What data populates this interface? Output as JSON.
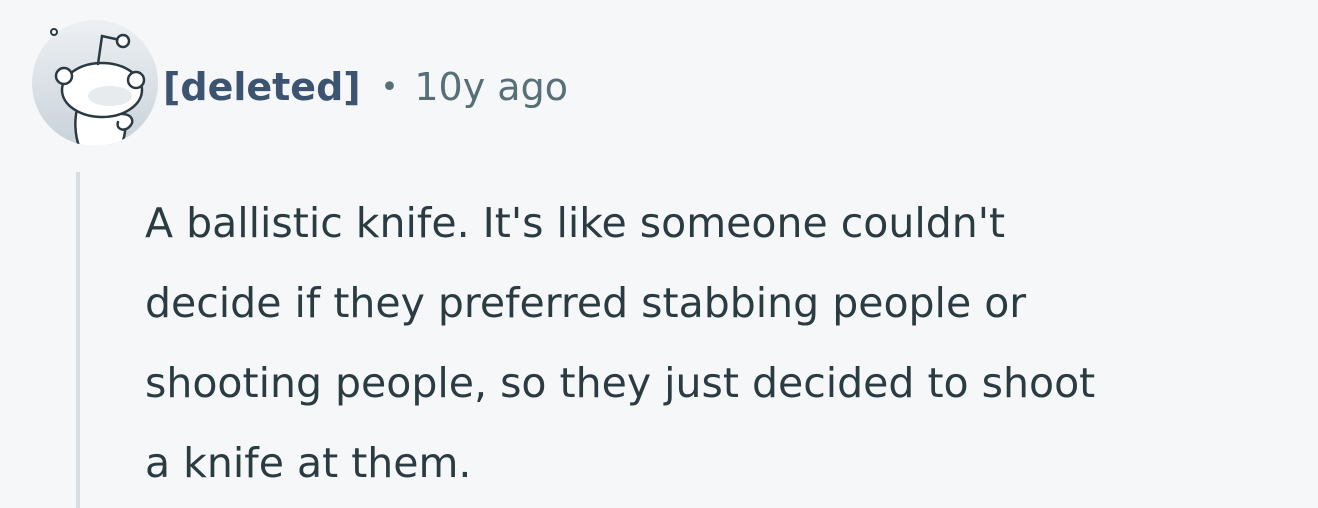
{
  "comment": {
    "author": "[deleted]",
    "separator": "•",
    "timestamp": "10y ago",
    "avatar_icon": "snoo-avatar-icon",
    "body_lines": [
      "A ballistic knife. It's like someone couldn't",
      "decide if they preferred stabbing people or",
      "shooting people, so they just decided to shoot",
      "a knife at them."
    ]
  },
  "colors": {
    "background": "#f6f7f8",
    "author": "#3d5470",
    "meta": "#576f76",
    "body": "#2a3c42",
    "thread_line": "#d7dde1"
  }
}
